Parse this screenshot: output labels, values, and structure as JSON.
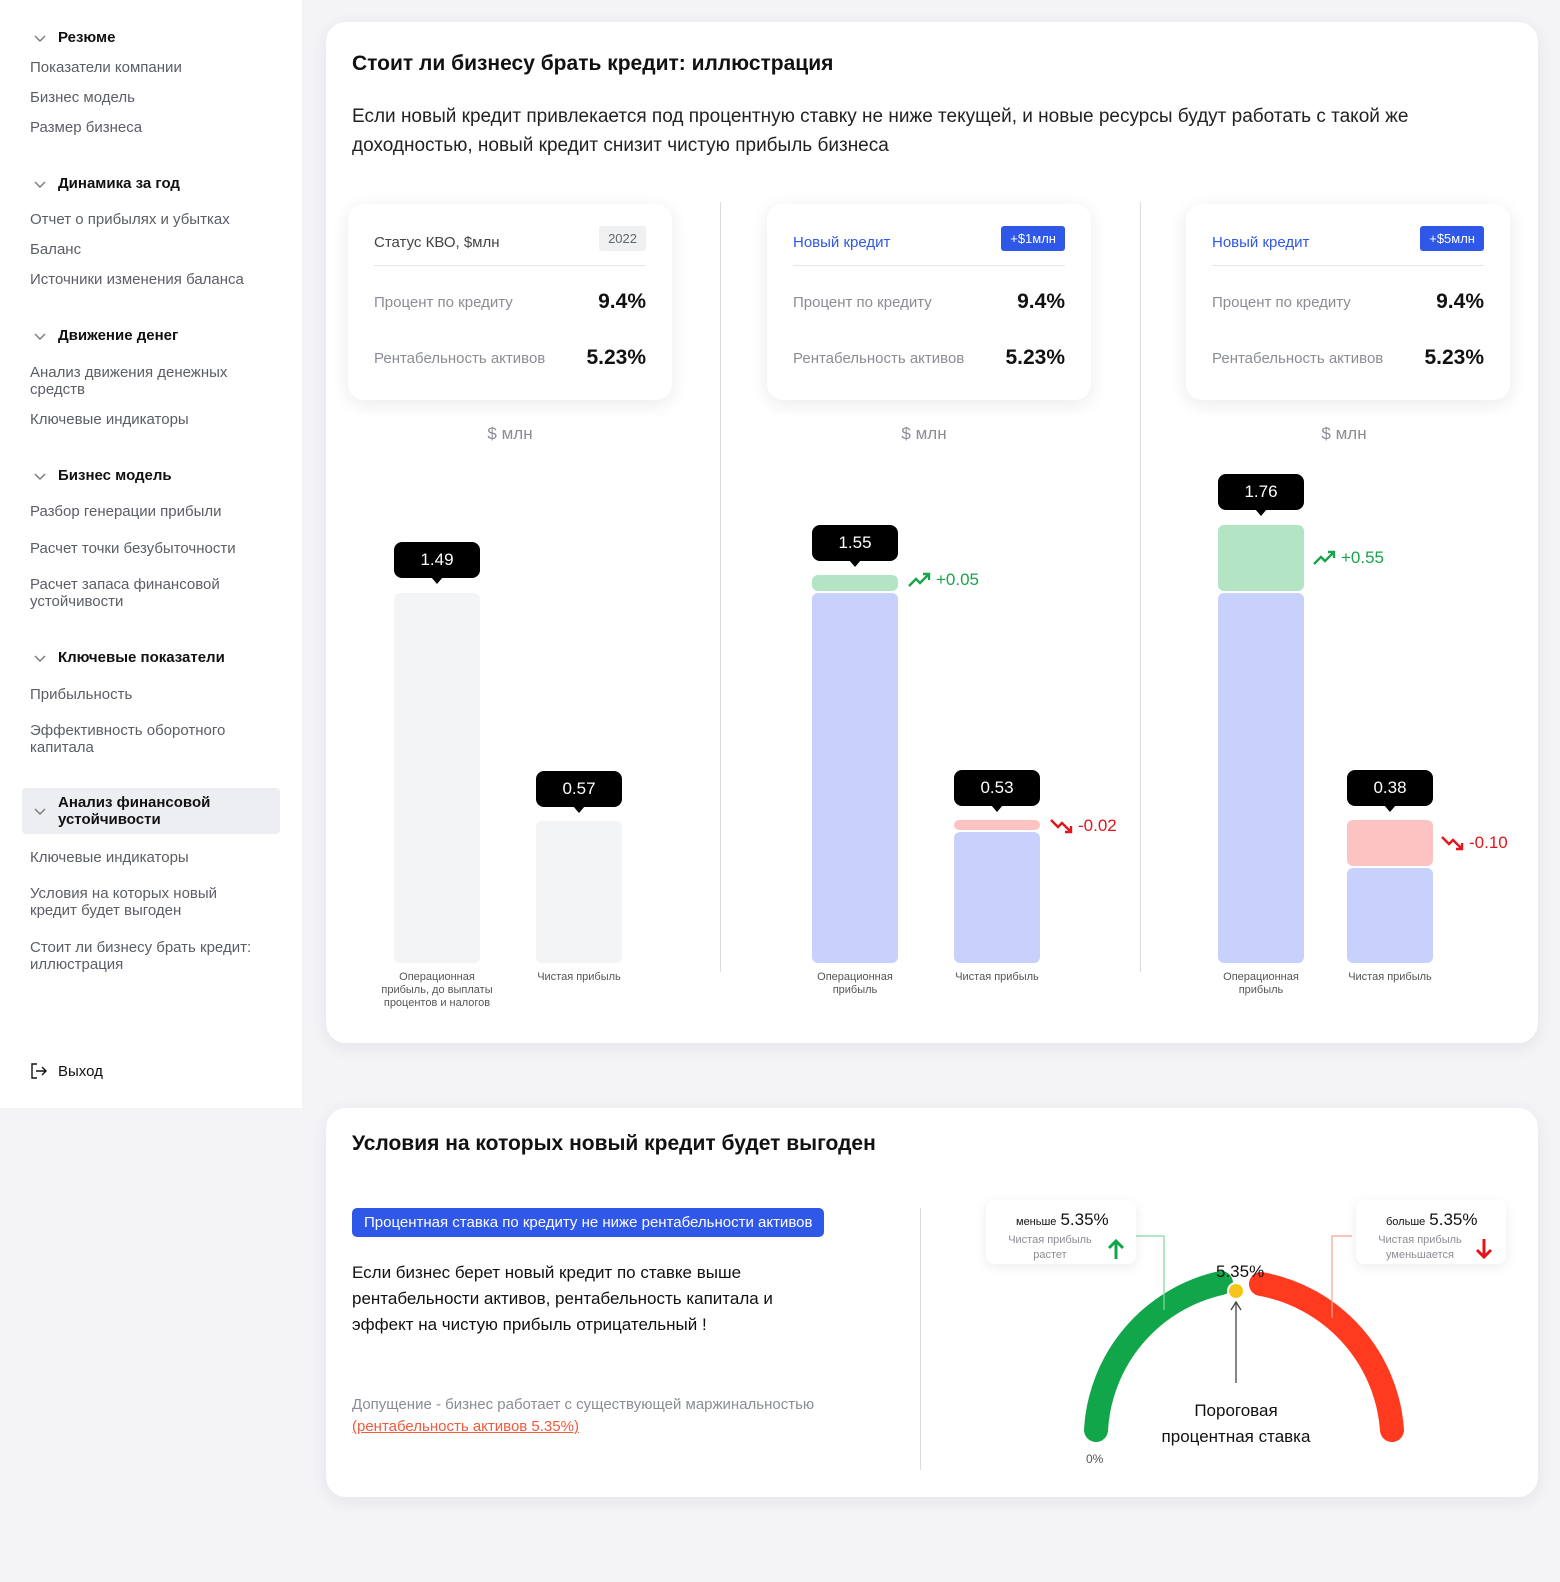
{
  "sidebar": {
    "sections": [
      {
        "title": "Резюме",
        "items": [
          "Показатели компании",
          "Бизнес модель",
          "Размер бизнеса"
        ]
      },
      {
        "title": "Динамика за год",
        "items": [
          "Отчет о прибылях и убытках",
          "Баланс",
          "Источники изменения баланса"
        ]
      },
      {
        "title": "Движение денег",
        "items": [
          "Анализ движения денежных средств",
          "Ключевые индикаторы"
        ]
      },
      {
        "title": "Бизнес модель",
        "items": [
          "Разбор генерации прибыли",
          "Расчет точки безубыточности",
          "Расчет  запаса финансовой устойчивости"
        ]
      },
      {
        "title": "Ключевые показатели",
        "items": [
          "Прибыльность",
          "Эффективность оборотного капитала"
        ]
      },
      {
        "title": "Анализ финансовой устойчивости",
        "items": [
          "Ключевые индикаторы",
          "Условия на которых новый кредит будет выгоден",
          "Стоит ли бизнесу брать кредит: иллюстрация"
        ]
      }
    ],
    "logout": "Выход"
  },
  "illustration": {
    "title": "Стоит ли бизнесу брать кредит: иллюстрация",
    "lead": "Если новый кредит привлекается под процентную ставку не ниже текущей, и новые ресурсы будут работать с такой же доходностью, новый кредит снизит чистую прибыль бизнеса",
    "unit": "$ млн",
    "rate_label": "Процент по кредиту",
    "roa_label": "Рентабельность активов",
    "panels": [
      {
        "label": "Статус КВО, $млн",
        "tag": "2022",
        "rate": "9.4%",
        "roa": "5.23%",
        "op_value": "1.49",
        "net_value": "0.57",
        "op_label": "Операционная прибыль, до выплаты процентов и налогов",
        "net_label": "Чистая прибыль"
      },
      {
        "label": "Новый кредит",
        "tag": "+$1млн",
        "rate": "9.4%",
        "roa": "5.23%",
        "op_value": "1.55",
        "net_value": "0.53",
        "op_delta": "+0.05",
        "net_delta": "-0.02",
        "op_label": "Операционная прибыль",
        "net_label": "Чистая прибыль"
      },
      {
        "label": "Новый кредит",
        "tag": "+$5млн",
        "rate": "9.4%",
        "roa": "5.23%",
        "op_value": "1.76",
        "net_value": "0.38",
        "op_delta": "+0.55",
        "net_delta": "-0.10",
        "op_label": "Операционная прибыль",
        "net_label": "Чистая прибыль"
      }
    ]
  },
  "conditions": {
    "title": "Условия на которых новый кредит будет выгоден",
    "pill": "Процентная ставка по кредиту не ниже рентабельности активов",
    "paragraph": "Если бизнес берет новый кредит по ставке выше рентабельности активов, рентабельность капитала и эффект на чистую прибыль отрицательный !",
    "assumption": "Допущение - бизнес работает   с существующей маржинальностью",
    "assumption_link": "(рентабельность активов 5.35%)",
    "left_box": {
      "prefix": "меньше",
      "value": "5.35%",
      "sub": "Чистая прибыль растет"
    },
    "right_box": {
      "prefix": "больше",
      "value": "5.35%",
      "sub": "Чистая прибыль уменьшается"
    },
    "gauge_value": "5.35%",
    "gauge_caption": "Пороговая процентная ставка",
    "gauge_min": "0%"
  },
  "colors": {
    "accent": "#2F57E8",
    "up": "#1AA34A",
    "down": "#E3141B",
    "gauge_green": "#12A64A",
    "gauge_red": "#FF3A1F"
  }
}
